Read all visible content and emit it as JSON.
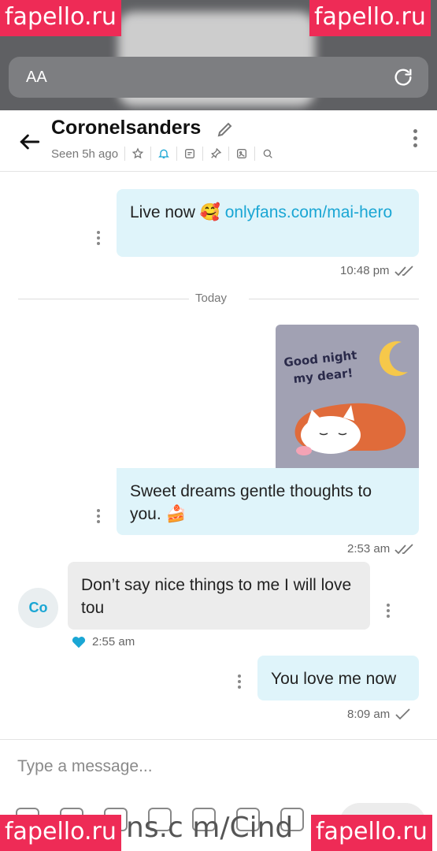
{
  "browser": {
    "font_size_label": "AA"
  },
  "watermarks": [
    "fapello.ru",
    "fapello.ru",
    "fapello.ru",
    "fapello.ru"
  ],
  "footer_overlay_text": "ns.c m/Cind",
  "header": {
    "title": "Coronelsanders",
    "seen": "Seen 5h ago"
  },
  "messages": {
    "m1": {
      "text_before": "Live now 🥰 ",
      "link": "onlyfans.com/mai-hero",
      "time": "10:48 pm"
    },
    "day_divider": "Today",
    "sticker": {
      "line1": "Good night",
      "line2": "my dear!"
    },
    "m2": {
      "text": "Sweet dreams gentle thoughts to you. 🍰",
      "time": "2:53 am"
    },
    "m3": {
      "avatar": "Co",
      "text": "Don’t say nice things to me I will love tou",
      "time": "2:55 am"
    },
    "m4": {
      "text": "You love me now",
      "time": "8:09 am"
    }
  },
  "composer": {
    "placeholder": "Type a message..."
  },
  "colors": {
    "accent": "#1aa6d4",
    "outgoing": "#dff4fa",
    "incoming": "#ececec",
    "watermark": "#ee2b56"
  }
}
